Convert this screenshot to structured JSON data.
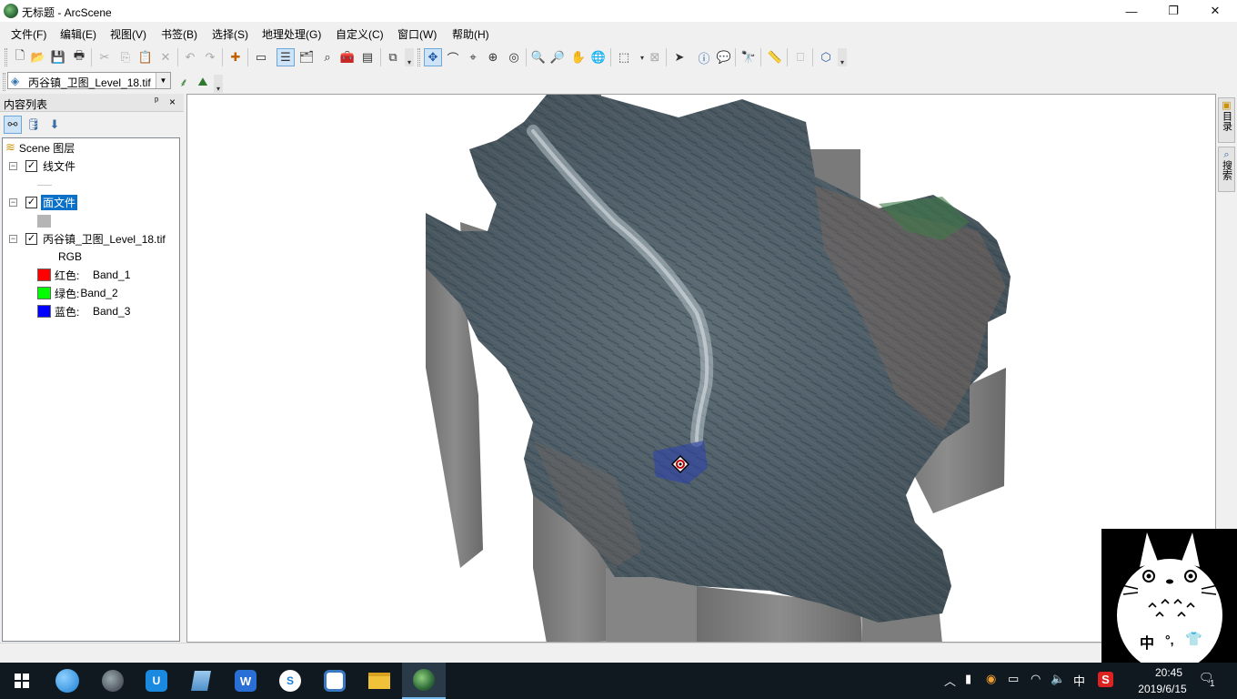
{
  "window": {
    "title": "无标题 - ArcScene",
    "controls": {
      "minimize": "—",
      "maximize": "❐",
      "close": "✕"
    }
  },
  "menu": [
    "文件(F)",
    "编辑(E)",
    "视图(V)",
    "书签(B)",
    "选择(S)",
    "地理处理(G)",
    "自定义(C)",
    "窗口(W)",
    "帮助(H)"
  ],
  "toolbar": {
    "layer_dropdown": {
      "selected": "丙谷镇_卫图_Level_18.tif"
    }
  },
  "toc": {
    "title": "内容列表",
    "pin": "ᵖ",
    "close": "×",
    "root": "Scene 图层",
    "layers": [
      {
        "name": "线文件",
        "checked": true,
        "expanded": true
      },
      {
        "name": "面文件",
        "checked": true,
        "expanded": true,
        "selected": true
      },
      {
        "name": "丙谷镇_卫图_Level_18.tif",
        "checked": true,
        "expanded": true,
        "renderer": "RGB",
        "bands": [
          {
            "label": "红色:",
            "band": "Band_1",
            "color": "#ff0000"
          },
          {
            "label": "绿色:",
            "band": "Band_2",
            "color": "#00ff00"
          },
          {
            "label": "蓝色:",
            "band": "Band_3",
            "color": "#0000ff"
          }
        ]
      }
    ],
    "fill_swatch_color": "#b5b5b5"
  },
  "right_dock": {
    "tabs": [
      "目录",
      "搜索"
    ]
  },
  "taskbar": {
    "apps": [
      "sogou-browser-icon",
      "globe-icon",
      "uudesk-icon",
      "notebook-icon",
      "wps-icon",
      "sogou-search-icon",
      "cloud-icon",
      "file-explorer-icon",
      "arcscene-icon"
    ],
    "tray": {
      "ime": "中",
      "notification_count": "1"
    },
    "clock": {
      "time": "20:45",
      "date": "2019/6/15"
    }
  },
  "overlay": {
    "char1": "中",
    "char2": "°,"
  }
}
